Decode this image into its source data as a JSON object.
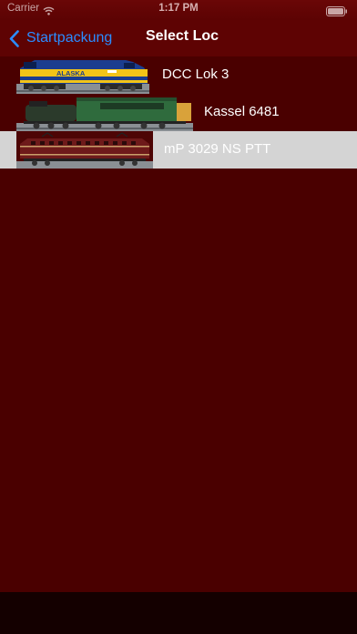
{
  "status_bar": {
    "carrier": "Carrier",
    "time": "1:17 PM"
  },
  "nav": {
    "back_label": "Startpackung",
    "title": "Select Loc"
  },
  "locos": [
    {
      "name": "DCC Lok 3",
      "livery": "Alaska"
    },
    {
      "name": "Kassel 6481"
    },
    {
      "name": "mP 3029 NS PTT",
      "selected": true
    }
  ],
  "colors": {
    "background": "#4a0000",
    "navbar": "#5e0303",
    "accent": "#2b8cff",
    "selected_row": "#d4d4d4"
  }
}
